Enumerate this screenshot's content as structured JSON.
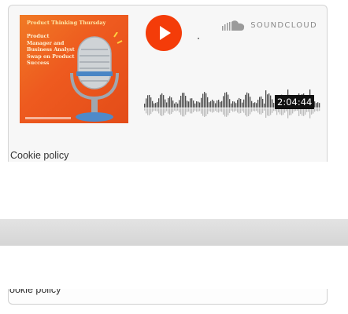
{
  "artwork": {
    "title": "Product Thinking Thursday",
    "subtitle": "Product Manager and Business Analyst Swap on Product Success"
  },
  "player": {
    "brand": "SOUNDCLOUD",
    "duration": "2:04:44",
    "play_icon": "play-icon",
    "brand_icon": "soundcloud-cloud-icon",
    "accent_color": "#f43c09"
  },
  "cookie_policy": {
    "label": "Cookie policy"
  }
}
